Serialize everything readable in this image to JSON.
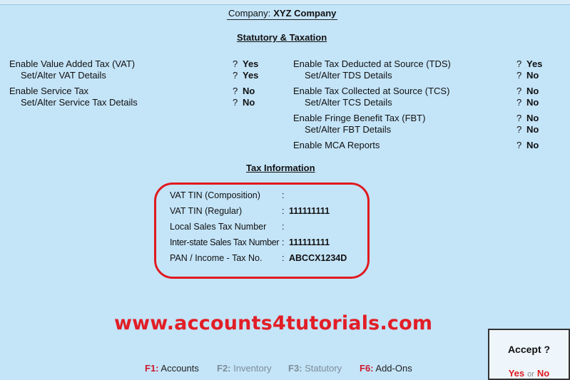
{
  "company": {
    "label": "Company:",
    "name": "XYZ Company"
  },
  "statutory": {
    "heading": "Statutory & Taxation",
    "left": [
      {
        "label": "Enable Value Added Tax (VAT)",
        "q": "?",
        "value": "Yes"
      },
      {
        "label": "Set/Alter VAT Details",
        "q": "?",
        "value": "Yes"
      },
      {
        "label": "Enable Service Tax",
        "q": "?",
        "value": "No"
      },
      {
        "label": "Set/Alter Service Tax Details",
        "q": "?",
        "value": "No"
      }
    ],
    "right": [
      {
        "label": "Enable Tax Deducted at Source (TDS)",
        "q": "?",
        "value": "Yes"
      },
      {
        "label": "Set/Alter TDS Details",
        "q": "?",
        "value": "No"
      },
      {
        "label": "Enable Tax Collected at Source (TCS)",
        "q": "?",
        "value": "No"
      },
      {
        "label": "Set/Alter TCS Details",
        "q": "?",
        "value": "No"
      },
      {
        "label": "Enable Fringe Benefit Tax (FBT)",
        "q": "?",
        "value": "No"
      },
      {
        "label": "Set/Alter FBT Details",
        "q": "?",
        "value": "No"
      },
      {
        "label": "Enable MCA Reports",
        "q": "?",
        "value": "No"
      }
    ]
  },
  "tax_info": {
    "heading": "Tax Information",
    "rows": [
      {
        "label": "VAT TIN (Composition)",
        "colon": ":",
        "value": ""
      },
      {
        "label": "VAT TIN (Regular)",
        "colon": ":",
        "value": "111111111"
      },
      {
        "label": "Local Sales Tax Number",
        "colon": ":",
        "value": ""
      },
      {
        "label": "Inter-state Sales Tax Number",
        "colon": ":",
        "value": "111111111"
      },
      {
        "label": "PAN / Income - Tax No.",
        "colon": ":",
        "value": "ABCCX1234D"
      }
    ]
  },
  "watermark": "www.accounts4tutorials.com",
  "footer": [
    {
      "key": "F1:",
      "label": "Accounts"
    },
    {
      "key": "F2:",
      "label": "Inventory"
    },
    {
      "key": "F3:",
      "label": "Statutory"
    },
    {
      "key": "F6:",
      "label": "Add-Ons"
    }
  ],
  "accept": {
    "title": "Accept ?",
    "yes": "Yes",
    "or": "or",
    "no": "No"
  },
  "colors": {
    "background": "#c4e4f8",
    "accent_red": "#e0191e",
    "dim_text": "#7c8c98"
  }
}
